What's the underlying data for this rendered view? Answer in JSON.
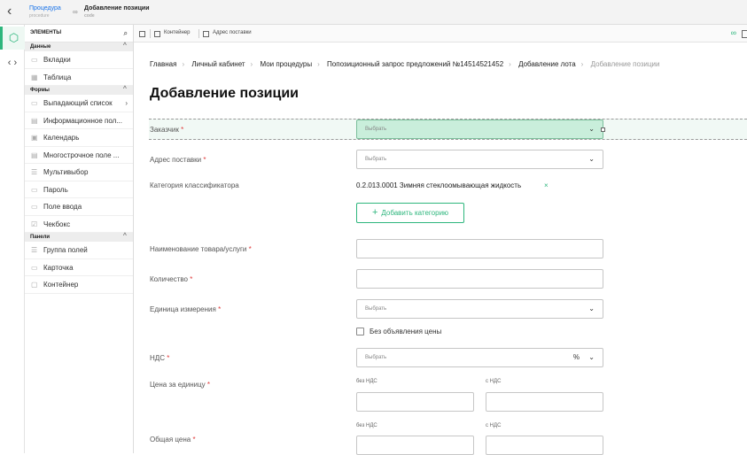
{
  "header": {
    "back_icon": "chevron-left-icon",
    "crumb1": {
      "label": "Процедура",
      "sub": "procedure"
    },
    "crumb2": {
      "label": "Добавление позиции",
      "sub": "code"
    }
  },
  "rail": {
    "active_icon": "puzzle-icon",
    "code_icon": "code-icon"
  },
  "sidebar": {
    "title": "ЭЛЕМЕНТЫ",
    "groups": [
      {
        "title": "Данные",
        "items": [
          {
            "label": "Вкладки"
          },
          {
            "label": "Таблица"
          }
        ]
      },
      {
        "title": "Формы",
        "items": [
          {
            "label": "Выпадающий список"
          },
          {
            "label": "Информационное пол..."
          },
          {
            "label": "Календарь"
          },
          {
            "label": "Многострочное поле ..."
          },
          {
            "label": "Мультивыбор"
          },
          {
            "label": "Пароль"
          },
          {
            "label": "Поле ввода"
          },
          {
            "label": "Чекбокс"
          }
        ]
      },
      {
        "title": "Панели",
        "items": [
          {
            "label": "Группа полей"
          },
          {
            "label": "Карточка"
          },
          {
            "label": "Контейнер"
          }
        ]
      }
    ]
  },
  "toolbar": {
    "container": "Контейнер",
    "address": "Адрес поставки"
  },
  "breadcrumb": [
    "Главная",
    "Личный кабинет",
    "Мои процедуры",
    "Попозиционный запрос предложений №14514521452",
    "Добавление лота",
    "Добавление позиции"
  ],
  "page_title": "Добавление позиции",
  "form": {
    "customer": {
      "label": "Заказчик",
      "placeholder": "Выбрать"
    },
    "address": {
      "label": "Адрес поставки",
      "placeholder": "Выбрать"
    },
    "category": {
      "label": "Категория классификатора",
      "value": "0.2.013.0001 Зимняя стеклоомывающая жидкость",
      "remove": "×",
      "add_button": "Добавить категорию"
    },
    "name": {
      "label": "Наименование товара/услуги"
    },
    "qty": {
      "label": "Количество"
    },
    "unit": {
      "label": "Единица измерения",
      "placeholder": "Выбрать"
    },
    "no_price": {
      "label": "Без объявления цены"
    },
    "vat": {
      "label": "НДС",
      "placeholder": "Выбрать",
      "unit": "%"
    },
    "unit_price": {
      "label": "Цена за единицу",
      "without_vat": "без НДС",
      "with_vat": "с НДС"
    },
    "total": {
      "label": "Общая цена",
      "without_vat": "без НДС",
      "with_vat": "с НДС"
    },
    "required_mark": "*"
  }
}
